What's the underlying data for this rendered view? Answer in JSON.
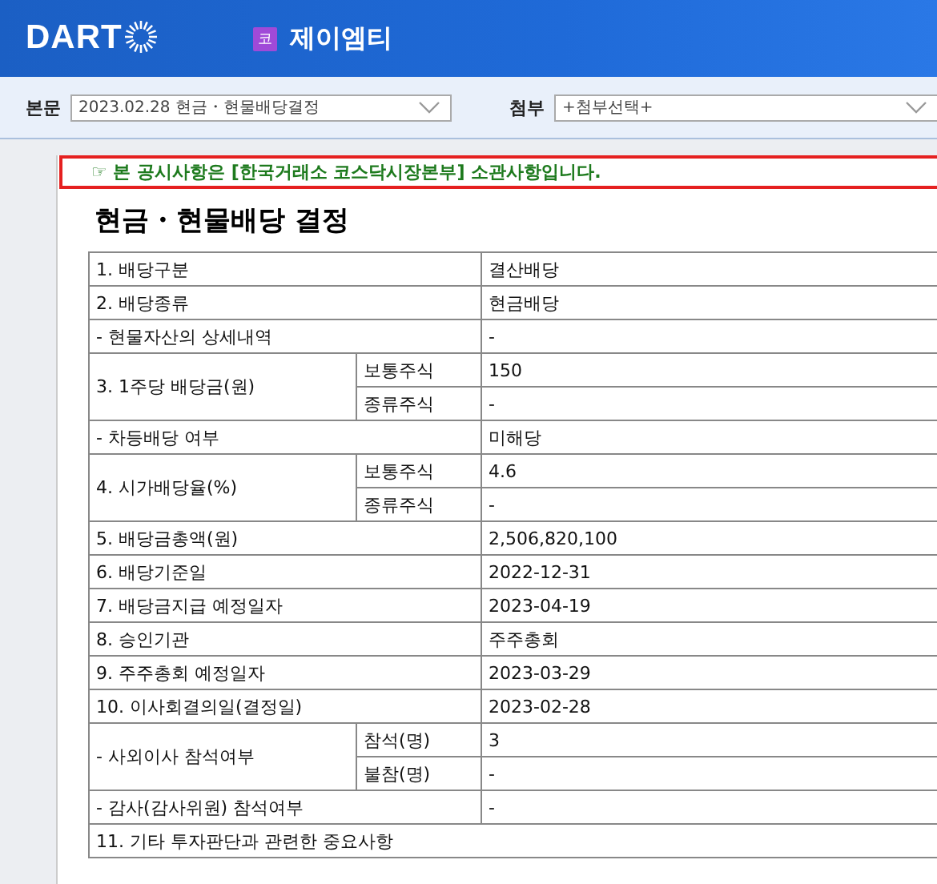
{
  "header": {
    "logo": "DART",
    "market_badge": "코",
    "company": "제이엠티"
  },
  "toolbar": {
    "main_label": "본문",
    "main_value": "2023.02.28  현금・현물배당결정",
    "attach_label": "첨부",
    "attach_value": "+첨부선택+"
  },
  "notice": {
    "icon": "☞",
    "text": "본 공시사항은 [한국거래소 코스닥시장본부] 소관사항입니다."
  },
  "title": "현금・현물배당 결정",
  "rows": [
    {
      "kind": "full",
      "label": "1. 배당구분",
      "value": "결산배당"
    },
    {
      "kind": "full",
      "label": "2. 배당종류",
      "value": "현금배당"
    },
    {
      "kind": "full",
      "label": "- 현물자산의 상세내역",
      "value": "-"
    },
    {
      "kind": "split",
      "label": "3. 1주당 배당금(원)",
      "subs": [
        {
          "label": "보통주식",
          "value": "150"
        },
        {
          "label": "종류주식",
          "value": "-"
        }
      ]
    },
    {
      "kind": "full",
      "label": "- 차등배당 여부",
      "value": "미해당"
    },
    {
      "kind": "split",
      "label": "4. 시가배당율(%)",
      "subs": [
        {
          "label": "보통주식",
          "value": "4.6"
        },
        {
          "label": "종류주식",
          "value": "-"
        }
      ]
    },
    {
      "kind": "full",
      "label": "5. 배당금총액(원)",
      "value": "2,506,820,100"
    },
    {
      "kind": "full",
      "label": "6. 배당기준일",
      "value": "2022-12-31"
    },
    {
      "kind": "full",
      "label": "7. 배당금지급 예정일자",
      "value": "2023-04-19"
    },
    {
      "kind": "full",
      "label": "8. 승인기관",
      "value": "주주총회"
    },
    {
      "kind": "full",
      "label": "9. 주주총회 예정일자",
      "value": "2023-03-29"
    },
    {
      "kind": "full",
      "label": "10. 이사회결의일(결정일)",
      "value": "2023-02-28"
    },
    {
      "kind": "split",
      "label": "- 사외이사 참석여부",
      "subs": [
        {
          "label": "참석(명)",
          "value": "3"
        },
        {
          "label": "불참(명)",
          "value": "-"
        }
      ]
    },
    {
      "kind": "full",
      "label": "- 감사(감사위원) 참석여부",
      "value": "-"
    },
    {
      "kind": "wide",
      "label": "11. 기타 투자판단과 관련한 중요사항"
    }
  ]
}
